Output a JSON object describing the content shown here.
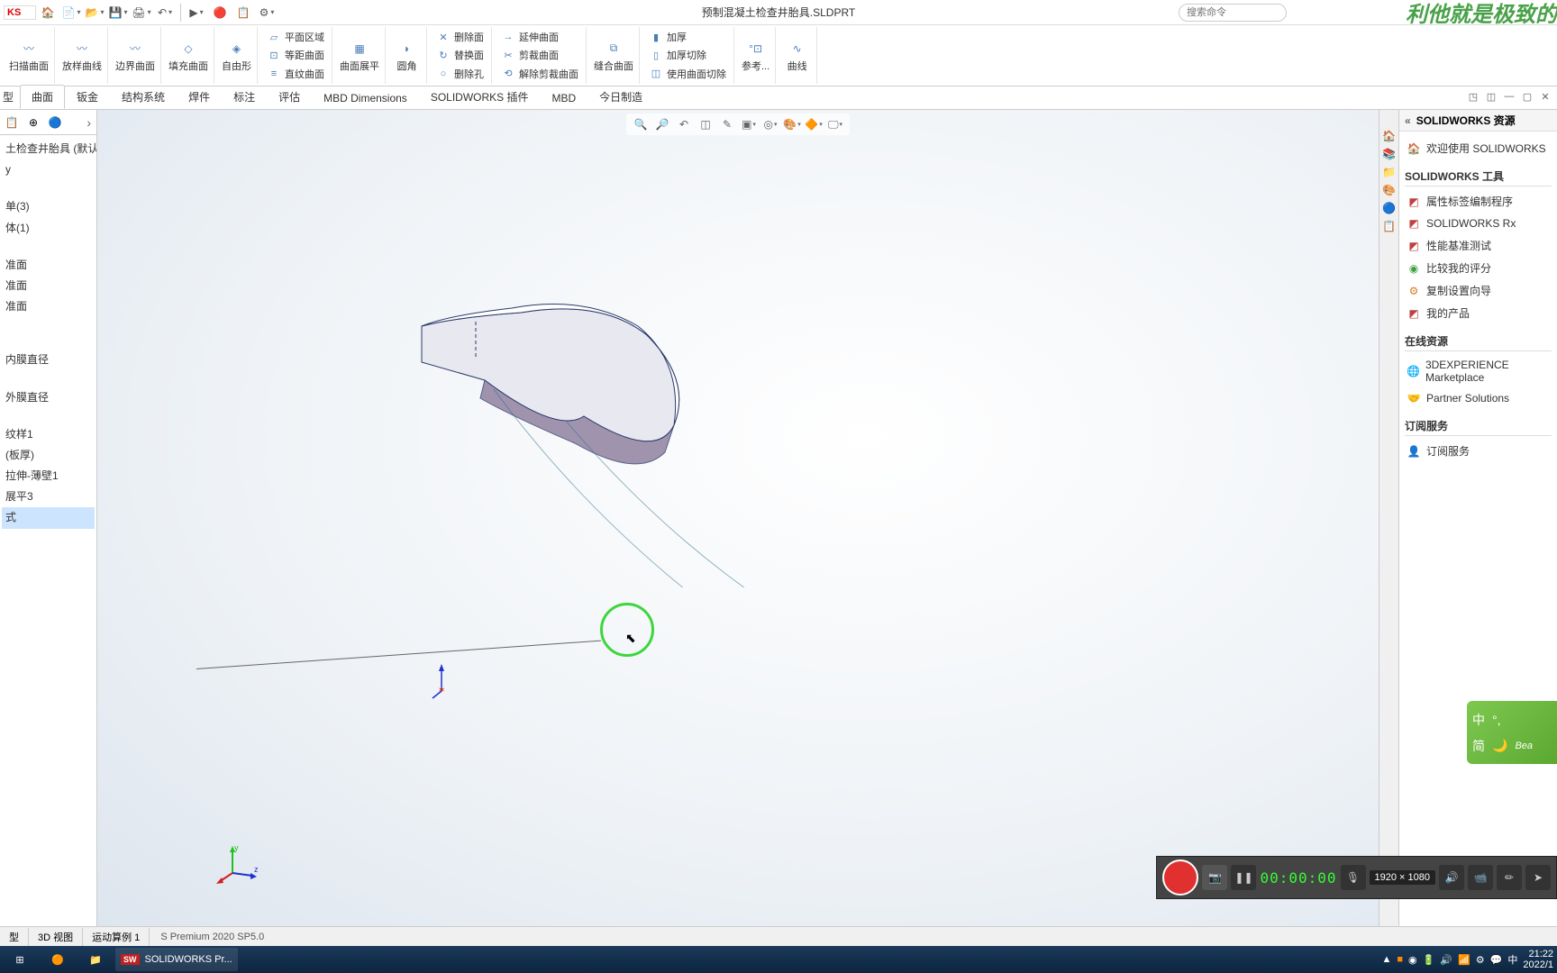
{
  "titlebar": {
    "logo": "KS",
    "doc_title": "预制混凝土检查井胎具.SLDPRT",
    "search_placeholder": "搜索命令",
    "watermark": "利他就是极致的"
  },
  "ribbon": {
    "big": [
      {
        "label": "扫描曲面"
      },
      {
        "label": "放样曲线"
      },
      {
        "label": "边界曲面"
      },
      {
        "label": "填充曲面"
      },
      {
        "label": "自由形"
      }
    ],
    "stack1": [
      "平面区域",
      "等距曲面",
      "直纹曲面"
    ],
    "big2": [
      {
        "label": "曲面展平"
      },
      {
        "label": "圆角"
      }
    ],
    "stack2": [
      "删除面",
      "替换面",
      "删除孔"
    ],
    "stack3": [
      "延伸曲面",
      "剪裁曲面",
      "解除剪裁曲面"
    ],
    "big3": [
      {
        "label": "缝合曲面"
      }
    ],
    "stack4": [
      "加厚",
      "加厚切除",
      "使用曲面切除"
    ],
    "big4": [
      {
        "label": "参考..."
      },
      {
        "label": "曲线"
      }
    ]
  },
  "tabs": {
    "items": [
      "曲面",
      "钣金",
      "结构系统",
      "焊件",
      "标注",
      "评估",
      "MBD Dimensions",
      "SOLIDWORKS 插件",
      "MBD",
      "今日制造"
    ],
    "active_index": 0,
    "left_cut": "型"
  },
  "feature_tree": {
    "root": "土检查井胎具 (默认<",
    "items": [
      "单(3)",
      "体(1)"
    ],
    "planes": [
      "准面",
      "准面",
      "准面"
    ],
    "features": [
      "内膜直径",
      "外膜直径",
      "纹样1",
      "(板厚)",
      "拉伸-薄壁1",
      "展平3"
    ],
    "style_row": "式"
  },
  "resources": {
    "title": "SOLIDWORKS 资源",
    "welcome": "欢迎使用 SOLIDWORKS",
    "tools_header": "SOLIDWORKS 工具",
    "tools": [
      "属性标签编制程序",
      "SOLIDWORKS Rx",
      "性能基准测试",
      "比较我的评分",
      "复制设置向导",
      "我的产品"
    ],
    "online_header": "在线资源",
    "online": [
      "3DEXPERIENCE Marketplace",
      "Partner Solutions"
    ],
    "sub_header": "订阅服务",
    "sub": [
      "订阅服务"
    ]
  },
  "ime": {
    "r1a": "中",
    "r1b": "°,",
    "r2a": "简",
    "r2b": "Bea"
  },
  "recorder": {
    "time": "00:00:00",
    "dim": "1920 × 1080"
  },
  "bottom_tabs": {
    "items": [
      "型",
      "3D 视图",
      "运动算例 1"
    ],
    "status": "S Premium 2020 SP5.0"
  },
  "taskbar": {
    "app_label": "SOLIDWORKS Pr...",
    "clock_time": "21:22",
    "clock_date": "2022/1",
    "ime_lang": "中"
  }
}
